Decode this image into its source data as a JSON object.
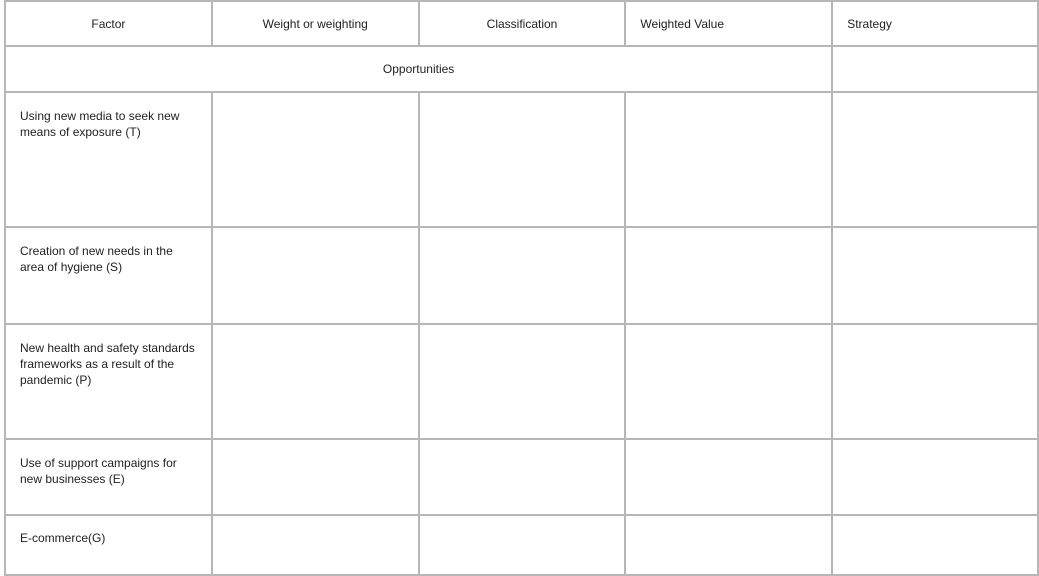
{
  "table": {
    "headers": [
      "Factor",
      "Weight or weighting",
      "Classification",
      "Weighted Value",
      "Strategy"
    ],
    "section_label": "Opportunities",
    "rows": [
      {
        "factor": "Using new media to seek new means of exposure (T)",
        "weight": "",
        "classification": "",
        "weighted_value": "",
        "strategy": ""
      },
      {
        "factor": "Creation of new needs in the area of hygiene (S)",
        "weight": "",
        "classification": "",
        "weighted_value": "",
        "strategy": ""
      },
      {
        "factor": "New health and safety standards frameworks as a result of the pandemic (P)",
        "weight": "",
        "classification": "",
        "weighted_value": "",
        "strategy": ""
      },
      {
        "factor": "Use of support campaigns for new businesses (E)",
        "weight": "",
        "classification": "",
        "weighted_value": "",
        "strategy": ""
      },
      {
        "factor": "E-commerce(G)",
        "weight": "",
        "classification": "",
        "weighted_value": "",
        "strategy": ""
      }
    ]
  }
}
